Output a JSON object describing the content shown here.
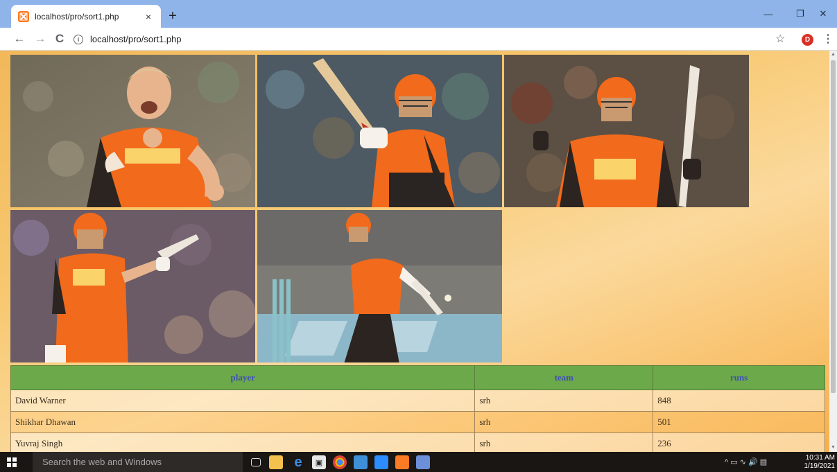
{
  "browser": {
    "tab_title": "localhost/pro/sort1.php",
    "tab_close": "×",
    "new_tab": "+",
    "url": "localhost/pro/sort1.php",
    "profile_initial": "D",
    "controls": {
      "minimize": "—",
      "restore": "❐",
      "close": "✕"
    },
    "nav": {
      "back": "←",
      "forward": "→",
      "reload": "C",
      "info": "i",
      "bookmark": "☆",
      "menu": "⋮"
    }
  },
  "gallery": {
    "photos": [
      {
        "subject": "player celebrating fist pump"
      },
      {
        "subject": "batsman raising bat"
      },
      {
        "subject": "batsman raising bat in helmet"
      },
      {
        "subject": "batsman acknowledging crowd"
      },
      {
        "subject": "batsman playing shot"
      }
    ]
  },
  "table": {
    "headers": [
      "player",
      "team",
      "runs"
    ],
    "rows": [
      [
        "David Warner",
        "srh",
        "848"
      ],
      [
        "Shikhar Dhawan",
        "srh",
        "501"
      ],
      [
        "Yuvraj Singh",
        "srh",
        "236"
      ]
    ]
  },
  "taskbar": {
    "search_placeholder": "Search the web and Windows",
    "time": "10:31 AM",
    "date": "1/19/2021"
  },
  "colors": {
    "tab_strip": "#8eb4e9",
    "table_header": "#6ca94a",
    "header_text": "#3f4fb5",
    "jersey_orange": "#f26a1b"
  }
}
